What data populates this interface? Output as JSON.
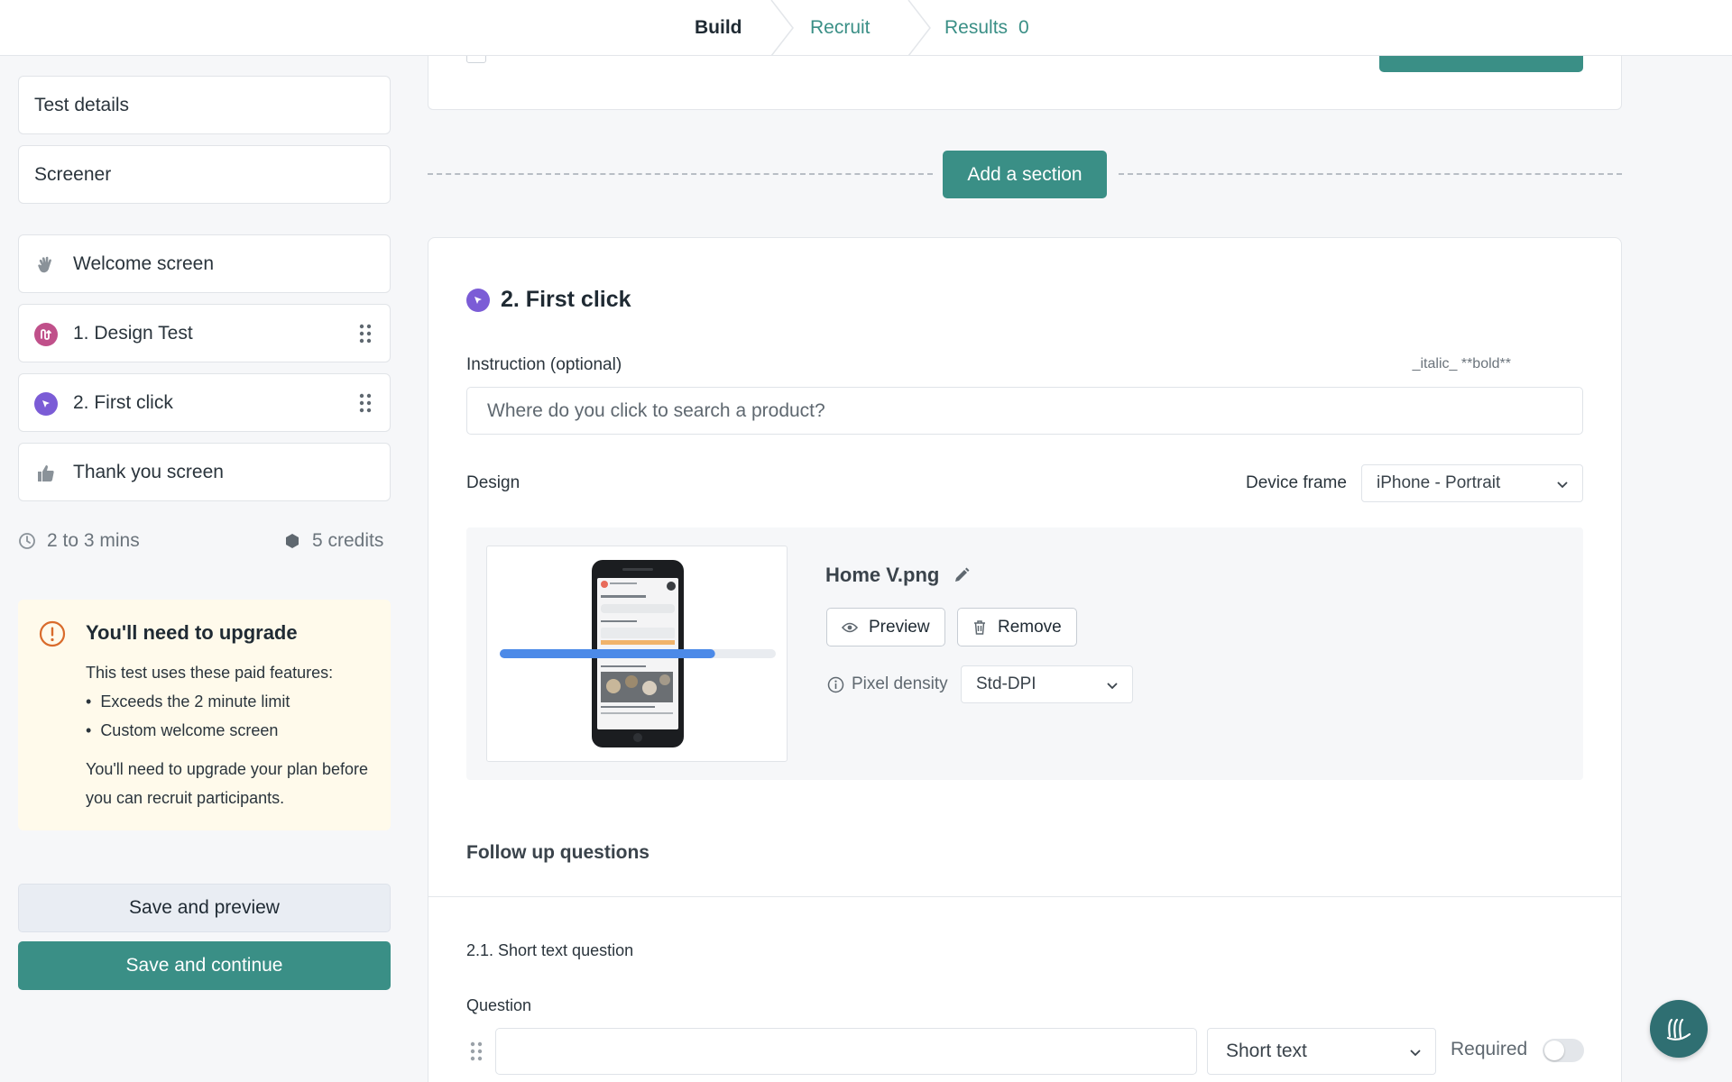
{
  "nav": {
    "tabs": [
      {
        "label": "Build"
      },
      {
        "label": "Recruit"
      },
      {
        "label": "Results",
        "count": "0"
      }
    ]
  },
  "sidebar": {
    "test_details": "Test details",
    "screener": "Screener",
    "items": [
      {
        "label": "Welcome screen",
        "icon": "wave-hand-icon"
      },
      {
        "label": "1. Design Test",
        "icon": "design-test-icon"
      },
      {
        "label": "2. First click",
        "icon": "cursor-click-icon"
      },
      {
        "label": "Thank you screen",
        "icon": "thumbs-up-icon"
      }
    ],
    "duration": "2 to 3 mins",
    "credits": "5 credits"
  },
  "upgrade": {
    "title": "You'll need to upgrade",
    "intro": "This test uses these paid features:",
    "features": [
      "Exceeds the 2 minute limit",
      "Custom welcome screen"
    ],
    "note": "You'll need to upgrade your plan before you can recruit participants."
  },
  "actions": {
    "save_preview": "Save and preview",
    "save_continue": "Save and continue"
  },
  "main": {
    "add_section": "Add a section",
    "section_title": "2. First click",
    "instruction_label": "Instruction (optional)",
    "format_hint": "_italic_ **bold**",
    "instruction_value": "Where do you click to search a product?",
    "design_label": "Design",
    "device_frame_label": "Device frame",
    "device_frame_value": "iPhone - Portrait",
    "file_name": "Home V.png",
    "preview_label": "Preview",
    "remove_label": "Remove",
    "pixel_density_label": "Pixel density",
    "pixel_density_value": "Std-DPI",
    "upload_progress": 0.78,
    "follow_up_title": "Follow up questions",
    "question_heading": "2.1. Short text question",
    "question_label": "Question",
    "question_value": "",
    "question_type": "Short text",
    "required_label": "Required",
    "required_on": false
  },
  "colors": {
    "accent": "#3a8f86",
    "first_click": "#7b5cd6",
    "design_test": "#c0508a",
    "progress": "#4c8ae8",
    "upgrade_bg": "#fffaeb",
    "warning": "#d96b2b"
  }
}
